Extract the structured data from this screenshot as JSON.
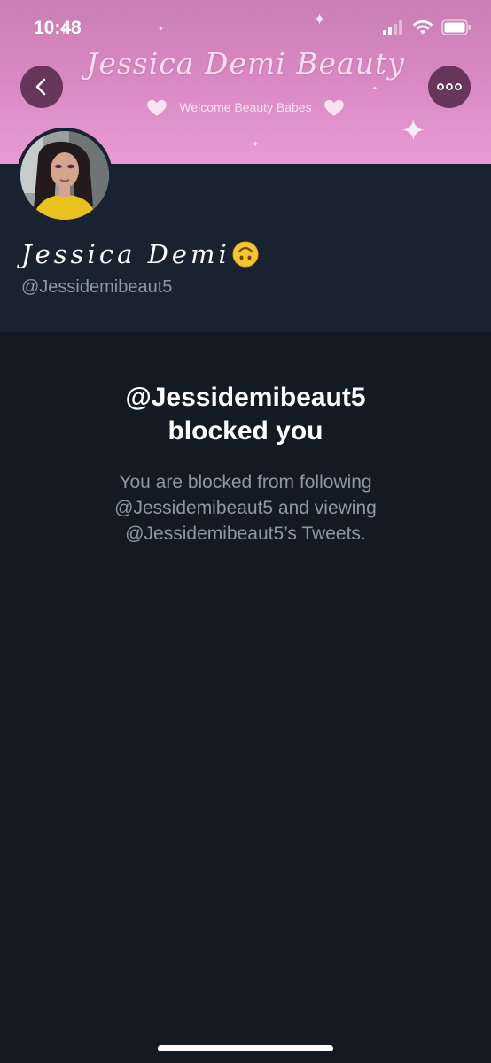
{
  "status_bar": {
    "time": "10:48"
  },
  "banner": {
    "title": "Jessica Demi Beauty",
    "subtitle": "Welcome Beauty Babes"
  },
  "profile": {
    "display_name": "Jessica Demi",
    "handle": "@Jessidemibeaut5",
    "name_emoji": "upside-down-face-emoji"
  },
  "blocked": {
    "title_line1": "@Jessidemibeaut5",
    "title_line2": "blocked you",
    "desc_line1": "You are blocked from following",
    "desc_line2": "@Jessidemibeaut5 and viewing",
    "desc_line3": "@Jessidemibeaut5’s Tweets."
  },
  "icons": {
    "back": "chevron-left-icon",
    "more": "more-horizontal-icon",
    "signal": "cellular-signal-icon",
    "wifi": "wifi-icon",
    "battery": "battery-icon"
  },
  "colors": {
    "background": "#141a23",
    "profile_background": "#192230",
    "banner_pink": "#e79ad3",
    "secondary_text": "#8b98a5",
    "primary_text": "#ffffff"
  }
}
